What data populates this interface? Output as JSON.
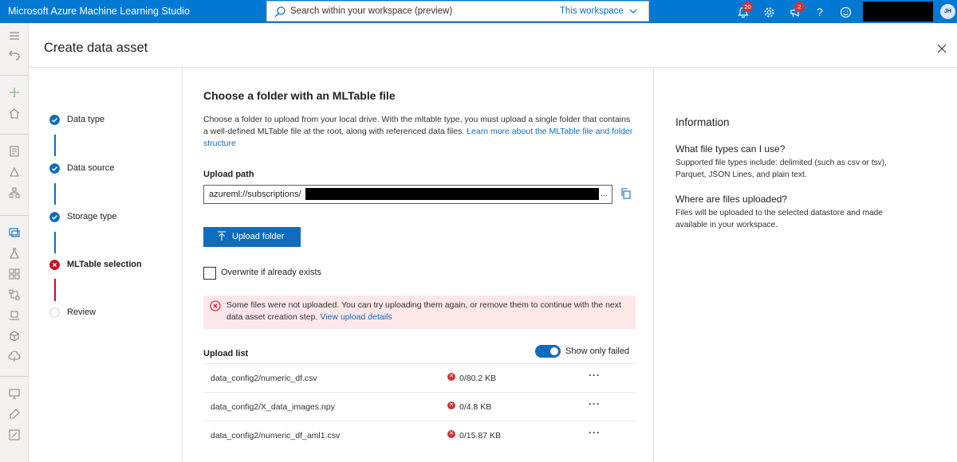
{
  "app": {
    "title": "Microsoft Azure Machine Learning Studio",
    "search_placeholder": "Search within your workspace (preview)",
    "search_scope": "This workspace",
    "notifications_count": "20",
    "announcements_count": "2",
    "avatar_initials": "JH",
    "accent_color": "#0078d4"
  },
  "panel": {
    "title": "Create data asset"
  },
  "steps": [
    {
      "label": "Data type",
      "state": "complete"
    },
    {
      "label": "Data source",
      "state": "complete"
    },
    {
      "label": "Storage type",
      "state": "complete"
    },
    {
      "label": "MLTable selection",
      "state": "error"
    },
    {
      "label": "Review",
      "state": "pending"
    }
  ],
  "main": {
    "heading": "Choose a folder with an MLTable file",
    "description": "Choose a folder to upload from your local drive. With the mltable type, you must upload a single folder that contains a well-defined MLTable file at the root, along with referenced data files.",
    "description_link": "Learn more about the MLTable file and folder structure",
    "upload_path_label": "Upload path",
    "upload_path_value": "azureml://subscriptions/",
    "upload_path_ellipsis": "...",
    "upload_button": "Upload folder",
    "overwrite_label": "Overwrite if already exists",
    "error_text": "Some files were not uploaded. You can try uploading them again, or remove them to continue with the next data asset creation step.",
    "error_link": "View upload details",
    "upload_list_label": "Upload list",
    "toggle_label": "Show only failed",
    "files": [
      {
        "name": "data_config2/numeric_df.csv",
        "size": "0/80.2 KB"
      },
      {
        "name": "data_config2/X_data_images.npy",
        "size": "0/4.8 KB"
      },
      {
        "name": "data_config2/numeric_df_aml1.csv",
        "size": "0/15.87 KB"
      }
    ],
    "more_label": "···"
  },
  "info": {
    "title": "Information",
    "q1": "What file types can I use?",
    "a1": "Supported file types include: delimited (such as csv or tsv), Parquet, JSON Lines, and plain text.",
    "q2": "Where are files uploaded?",
    "a2": "Files will be uploaded to the selected datastore and made available in your workspace."
  }
}
